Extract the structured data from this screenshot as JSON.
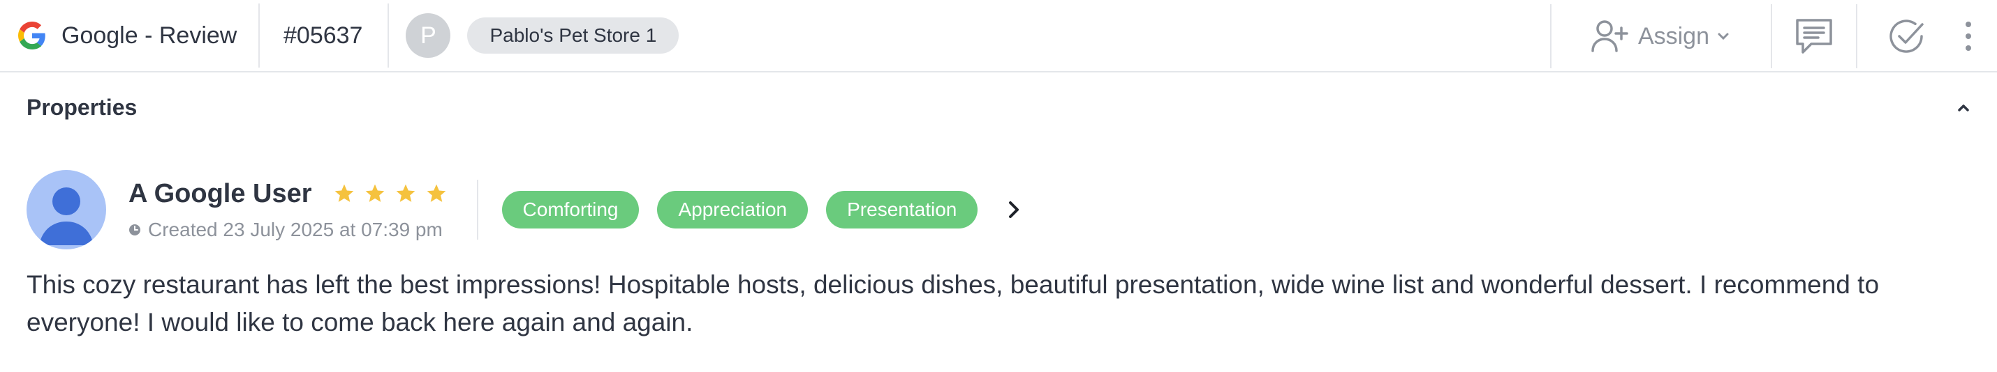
{
  "header": {
    "source_label": "Google - Review",
    "ticket_id": "#05637",
    "owner_initial": "P",
    "store_name": "Pablo's Pet Store 1",
    "assign_label": "Assign"
  },
  "properties": {
    "title": "Properties"
  },
  "review": {
    "author": "A Google User",
    "rating": 4,
    "created": "Created 23 July 2025 at 07:39 pm",
    "tags": [
      "Comforting",
      "Appreciation",
      "Presentation"
    ],
    "text": "This cozy restaurant has left the best impressions! Hospitable hosts, delicious dishes, beautiful presentation, wide wine list and wonderful dessert. I recommend to everyone! I would like to come back here again and again."
  },
  "colors": {
    "tag_green": "#6acb7d",
    "star_yellow": "#f5c23e",
    "avatar_blue": "#a9c3f7"
  },
  "icons": [
    "google-g-icon",
    "user-plus-icon",
    "chevron-down-icon",
    "chat-icon",
    "check-circle-icon",
    "more-vertical-icon",
    "chevron-up-icon",
    "clock-icon",
    "star-icon",
    "chevron-right-icon"
  ]
}
